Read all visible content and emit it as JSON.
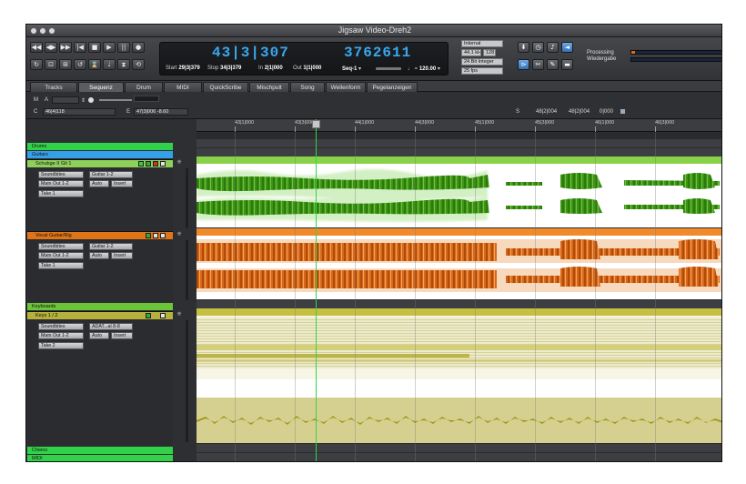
{
  "window": {
    "title": "Jigsaw Video-Dreh2"
  },
  "transport": {
    "buttons": [
      "◀◀",
      "◀▶",
      "▶▶",
      "|◀",
      "■",
      "▶",
      "||",
      "●"
    ],
    "counter_main": "43|3|307",
    "counter_sample": "3762611",
    "start_label": "Start",
    "start_value": "29|3|379",
    "stop_label": "Stop",
    "stop_value": "34|3|379",
    "in_label": "In",
    "in_value": "2|1|000",
    "out_label": "Out",
    "out_value": "1|1|000",
    "seq_value": "Seq-1",
    "tempo_value": "120.00"
  },
  "settings": {
    "sync_source": "Internal",
    "sample_rate": "44.1 kHz",
    "buffer": "128",
    "bit_depth": "24 Bit Integer",
    "frame_rate": "25 fps"
  },
  "status": {
    "processing_label": "Processing",
    "playback_label": "Wiedergabe",
    "processing_level": 0.04,
    "playback_level": 0.0
  },
  "tabs": [
    {
      "label": "Tracks",
      "active": false
    },
    {
      "label": "Sequenz",
      "active": true
    },
    {
      "label": "Drum",
      "active": false
    },
    {
      "label": "MIDI",
      "active": false
    },
    {
      "label": "QuickScribe",
      "active": false
    },
    {
      "label": "Mischpult",
      "active": false
    },
    {
      "label": "Song",
      "active": false
    },
    {
      "label": "Wellenform",
      "active": false
    },
    {
      "label": "Pegelanzeigen",
      "active": false
    }
  ],
  "infobar": {
    "m_label": "M",
    "a_label": "A",
    "c_label": "C",
    "c_value": "46|4|118",
    "e_label": "E",
    "e_value": "47|3|006 -8.60",
    "s_label": "S",
    "s_start": "48|2|004",
    "s_end": "48|2|004",
    "s_len": "0|000"
  },
  "ruler": {
    "labels": [
      "43|1|000",
      "43|3|000",
      "44|1|000",
      "44|3|000",
      "45|1|000",
      "45|3|000",
      "46|1|000",
      "46|3|000"
    ]
  },
  "folders": {
    "drums": "Drums",
    "guitars": "Guitars",
    "keyboards": "Keyboards",
    "chiens": "Chiens",
    "midi": "MIDI"
  },
  "tracks": [
    {
      "name": "Schubge II Git 1",
      "color": "#8ed05a",
      "input": "Soundbites",
      "output": "Guitar 1-2",
      "main": "Main Out 1-2",
      "auto": "Auto",
      "insert": "Insert",
      "take": "Take 1"
    },
    {
      "name": "Vocal Guitar/Rig",
      "color": "#e07418",
      "input": "Soundbites",
      "output": "Guitar 1-2",
      "main": "Main Out 1-2",
      "auto": "Auto",
      "insert": "Insert",
      "take": "Take 1"
    },
    {
      "name": "Keys 1 / 2",
      "color": "#b6b03c",
      "input": "Soundbites",
      "output": "ADAT...al 8-8",
      "main": "Main Out 1-2",
      "auto": "Auto",
      "insert": "Insert",
      "take": "Take 2"
    }
  ],
  "colors": {
    "lcd_blue": "#38a8f0",
    "folder_green": "#32d14a",
    "guitar_green": "#58c02e",
    "vocal_orange": "#e07418",
    "keys_yellow": "#b8b030",
    "playhead": "#34d34c"
  }
}
